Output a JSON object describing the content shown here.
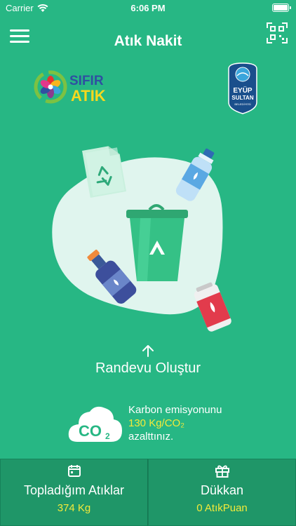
{
  "status_bar": {
    "carrier": "Carrier",
    "time": "6:06 PM"
  },
  "header": {
    "title": "Atık Nakit",
    "menu_icon": "hamburger-menu-icon",
    "qr_icon": "qr-scan-icon"
  },
  "logos": {
    "left": {
      "line1": "SIFIR",
      "line2": "ATIK"
    },
    "right": {
      "line1": "EYÜP",
      "line2": "SULTAN",
      "line3": "BELEDİYESİ"
    }
  },
  "appointment": {
    "label": "Randevu Oluştur",
    "icon": "arrow-up-icon"
  },
  "carbon": {
    "icon_label": "CO",
    "icon_sub": "2",
    "line1": "Karbon emisyonunu",
    "value": "130 Kg/CO₂",
    "line3": "azalttınız."
  },
  "bottom": {
    "collected": {
      "title": "Topladığım Atıklar",
      "value": "374 Kg",
      "icon": "calendar-icon"
    },
    "shop": {
      "title": "Dükkan",
      "value": "0 AtıkPuan",
      "icon": "gift-icon"
    }
  },
  "colors": {
    "background": "#27b784",
    "accent_yellow": "#f3ea3a",
    "bottom_bar": "#1f9668"
  }
}
